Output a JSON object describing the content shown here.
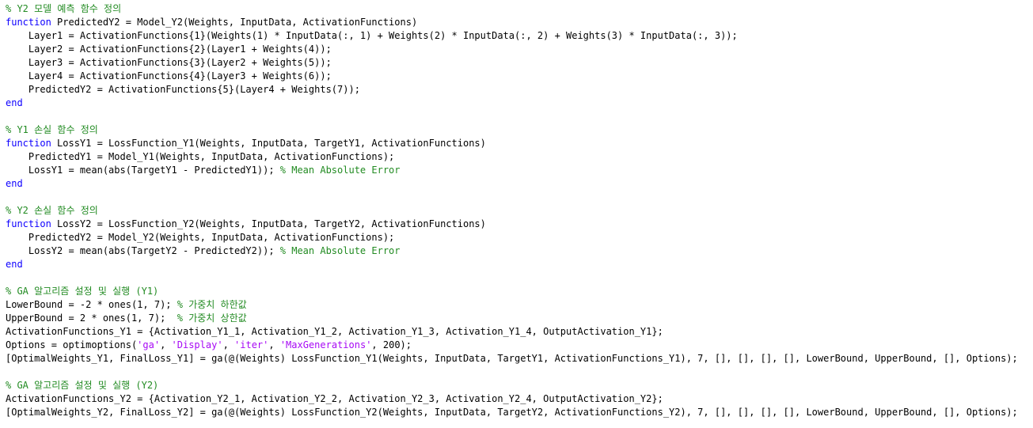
{
  "colors": {
    "keyword": "#0E00FF",
    "comment": "#228B22",
    "string": "#A709F5",
    "code": "#000000"
  },
  "lines": [
    [
      {
        "t": "cm",
        "s": "% Y2 모델 예측 함수 정의"
      }
    ],
    [
      {
        "t": "kw",
        "s": "function"
      },
      {
        "t": "code",
        "s": " PredictedY2 = Model_Y2(Weights, InputData, ActivationFunctions)"
      }
    ],
    [
      {
        "t": "code",
        "s": "    Layer1 = ActivationFunctions{1}(Weights(1) * InputData(:, 1) + Weights(2) * InputData(:, 2) + Weights(3) * InputData(:, 3));"
      }
    ],
    [
      {
        "t": "code",
        "s": "    Layer2 = ActivationFunctions{2}(Layer1 + Weights(4));"
      }
    ],
    [
      {
        "t": "code",
        "s": "    Layer3 = ActivationFunctions{3}(Layer2 + Weights(5));"
      }
    ],
    [
      {
        "t": "code",
        "s": "    Layer4 = ActivationFunctions{4}(Layer3 + Weights(6));"
      }
    ],
    [
      {
        "t": "code",
        "s": "    PredictedY2 = ActivationFunctions{5}(Layer4 + Weights(7));"
      }
    ],
    [
      {
        "t": "kw",
        "s": "end"
      }
    ],
    [],
    [
      {
        "t": "cm",
        "s": "% Y1 손실 함수 정의"
      }
    ],
    [
      {
        "t": "kw",
        "s": "function"
      },
      {
        "t": "code",
        "s": " LossY1 = LossFunction_Y1(Weights, InputData, TargetY1, ActivationFunctions)"
      }
    ],
    [
      {
        "t": "code",
        "s": "    PredictedY1 = Model_Y1(Weights, InputData, ActivationFunctions);"
      }
    ],
    [
      {
        "t": "code",
        "s": "    LossY1 = mean(abs(TargetY1 - PredictedY1)); "
      },
      {
        "t": "cm",
        "s": "% Mean Absolute Error"
      }
    ],
    [
      {
        "t": "kw",
        "s": "end"
      }
    ],
    [],
    [
      {
        "t": "cm",
        "s": "% Y2 손실 함수 정의"
      }
    ],
    [
      {
        "t": "kw",
        "s": "function"
      },
      {
        "t": "code",
        "s": " LossY2 = LossFunction_Y2(Weights, InputData, TargetY2, ActivationFunctions)"
      }
    ],
    [
      {
        "t": "code",
        "s": "    PredictedY2 = Model_Y2(Weights, InputData, ActivationFunctions);"
      }
    ],
    [
      {
        "t": "code",
        "s": "    LossY2 = mean(abs(TargetY2 - PredictedY2)); "
      },
      {
        "t": "cm",
        "s": "% Mean Absolute Error"
      }
    ],
    [
      {
        "t": "kw",
        "s": "end"
      }
    ],
    [],
    [
      {
        "t": "cm",
        "s": "% GA 알고리즘 설정 및 실행 (Y1)"
      }
    ],
    [
      {
        "t": "code",
        "s": "LowerBound = -2 * ones(1, 7); "
      },
      {
        "t": "cm",
        "s": "% 가중치 하한값"
      }
    ],
    [
      {
        "t": "code",
        "s": "UpperBound = 2 * ones(1, 7);  "
      },
      {
        "t": "cm",
        "s": "% 가중치 상한값"
      }
    ],
    [
      {
        "t": "code",
        "s": "ActivationFunctions_Y1 = {Activation_Y1_1, Activation_Y1_2, Activation_Y1_3, Activation_Y1_4, OutputActivation_Y1};"
      }
    ],
    [
      {
        "t": "code",
        "s": "Options = optimoptions("
      },
      {
        "t": "str",
        "s": "'ga'"
      },
      {
        "t": "code",
        "s": ", "
      },
      {
        "t": "str",
        "s": "'Display'"
      },
      {
        "t": "code",
        "s": ", "
      },
      {
        "t": "str",
        "s": "'iter'"
      },
      {
        "t": "code",
        "s": ", "
      },
      {
        "t": "str",
        "s": "'MaxGenerations'"
      },
      {
        "t": "code",
        "s": ", 200);"
      }
    ],
    [
      {
        "t": "code",
        "s": "[OptimalWeights_Y1, FinalLoss_Y1] = ga(@(Weights) LossFunction_Y1(Weights, InputData, TargetY1, ActivationFunctions_Y1), 7, [], [], [], [], LowerBound, UpperBound, [], Options);"
      }
    ],
    [],
    [
      {
        "t": "cm",
        "s": "% GA 알고리즘 설정 및 실행 (Y2)"
      }
    ],
    [
      {
        "t": "code",
        "s": "ActivationFunctions_Y2 = {Activation_Y2_1, Activation_Y2_2, Activation_Y2_3, Activation_Y2_4, OutputActivation_Y2};"
      }
    ],
    [
      {
        "t": "code",
        "s": "[OptimalWeights_Y2, FinalLoss_Y2] = ga(@(Weights) LossFunction_Y2(Weights, InputData, TargetY2, ActivationFunctions_Y2), 7, [], [], [], [], LowerBound, UpperBound, [], Options);"
      }
    ]
  ]
}
